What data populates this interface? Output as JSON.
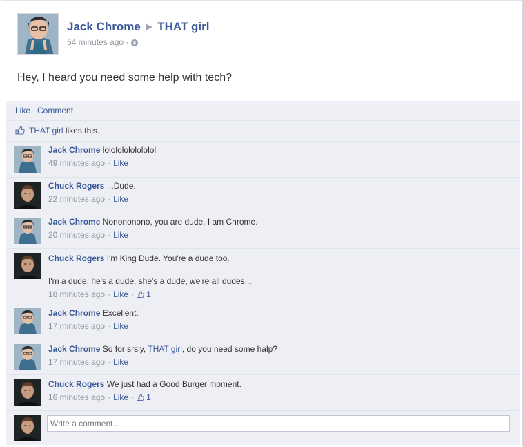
{
  "post": {
    "author": "Jack Chrome",
    "target": "THAT girl",
    "time": "54 minutes ago",
    "separator": "·",
    "text": "Hey, I heard you need some help with tech?"
  },
  "actions": {
    "like": "Like",
    "comment": "Comment",
    "dot": "·"
  },
  "likes": {
    "name": "THAT girl",
    "suffix": " likes this."
  },
  "comments": [
    {
      "author": "Jack Chrome",
      "text": "lolololololololol",
      "time": "49 minutes ago",
      "like": "Like",
      "avatar": "jack"
    },
    {
      "author": "Chuck Rogers",
      "text": "...Dude.",
      "time": "22 minutes ago",
      "like": "Like",
      "avatar": "chuck"
    },
    {
      "author": "Jack Chrome",
      "text": "Nonononono, you are dude. I am Chrome.",
      "time": "20 minutes ago",
      "like": "Like",
      "avatar": "jack"
    },
    {
      "author": "Chuck Rogers",
      "text": "I'm King Dude. You're a dude too.",
      "text2": "I'm a dude, he's a dude, she's a dude, we're all dudes...",
      "time": "18 minutes ago",
      "like": "Like",
      "like_count": "1",
      "avatar": "chuck"
    },
    {
      "author": "Jack Chrome",
      "text": "Excellent.",
      "time": "17 minutes ago",
      "like": "Like",
      "avatar": "jack"
    },
    {
      "author": "Jack Chrome",
      "text_pre": "So for srsly, ",
      "mention": "THAT girl",
      "text_post": ", do you need some halp?",
      "time": "17 minutes ago",
      "like": "Like",
      "avatar": "jack"
    },
    {
      "author": "Chuck Rogers",
      "text": "We just had a Good Burger moment.",
      "time": "16 minutes ago",
      "like": "Like",
      "like_count": "1",
      "avatar": "chuck"
    }
  ],
  "composer": {
    "placeholder": "Write a comment..."
  },
  "colors": {
    "link": "#3b5998",
    "feedback_bg": "#edeff4",
    "meta": "#90949c"
  }
}
